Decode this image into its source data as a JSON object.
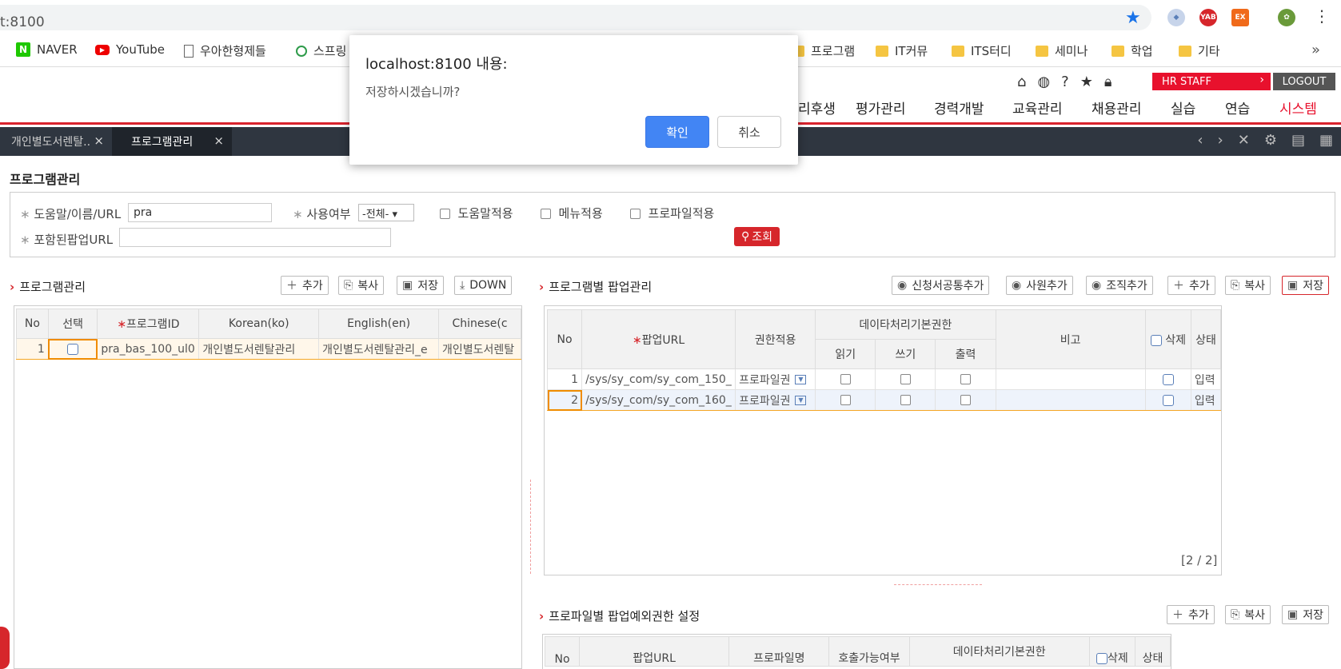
{
  "browser": {
    "address": "t:8100",
    "bookmarks": [
      {
        "label": "NAVER",
        "icon": "naver-icon"
      },
      {
        "label": "YouTube",
        "icon": "youtube-icon"
      },
      {
        "label": "우아한형제들",
        "icon": "page-icon"
      },
      {
        "label": "스프링",
        "icon": "spring-icon"
      },
      {
        "label": "프로그램",
        "icon": "folder-icon"
      },
      {
        "label": "IT커뮤",
        "icon": "folder-icon"
      },
      {
        "label": "ITS터디",
        "icon": "folder-icon"
      },
      {
        "label": "세미나",
        "icon": "folder-icon"
      },
      {
        "label": "학업",
        "icon": "folder-icon"
      },
      {
        "label": "기타",
        "icon": "folder-icon"
      }
    ],
    "more": "»"
  },
  "header": {
    "hr_staff": "HR STAFF",
    "logout": "LOGOUT",
    "menu": [
      "리후생",
      "평가관리",
      "경력개발",
      "교육관리",
      "채용관리",
      "실습",
      "연습",
      "시스템"
    ],
    "active_menu_color": "#e8112d"
  },
  "tabs": [
    {
      "label": "개인별도서렌탈..",
      "active": false
    },
    {
      "label": "프로그램관리",
      "active": true
    }
  ],
  "page": {
    "title": "프로그램관리",
    "search": {
      "help_label": "도움말/이름/URL",
      "help_value": "pra",
      "use_label": "사용여부",
      "use_value": "-전체-",
      "chk_help": "도움말적용",
      "chk_menu": "메뉴적용",
      "chk_profile": "프로파일적용",
      "popup_url_label": "포함된팝업URL",
      "popup_url_value": "",
      "search_btn": "조회"
    }
  },
  "left": {
    "title": "프로그램관리",
    "buttons": {
      "add": "추가",
      "copy": "복사",
      "save": "저장",
      "down": "DOWN"
    },
    "columns": [
      "No",
      "선택",
      "프로그램ID",
      "Korean(ko)",
      "English(en)",
      "Chinese(c"
    ],
    "rows": [
      {
        "no": "1",
        "id": "pra_bas_100_ul0",
        "ko": "개인별도서렌탈관리",
        "en": "개인별도서렌탈관리_e",
        "zh": "개인별도서렌탈"
      }
    ]
  },
  "right": {
    "title": "프로그램별 팝업관리",
    "buttons": {
      "app_common": "신청서공통추가",
      "emp": "사원추가",
      "org": "조직추가",
      "add": "추가",
      "copy": "복사",
      "save": "저장"
    },
    "columns": {
      "no": "No",
      "url": "팝업URL",
      "auth": "권한적용",
      "data_group": "데이타처리기본권한",
      "read": "읽기",
      "write": "쓰기",
      "print": "출력",
      "note": "비고",
      "delete": "삭제",
      "status": "상태"
    },
    "rows": [
      {
        "no": "1",
        "url": "/sys/sy_com/sy_com_150_",
        "auth": "프로파일권",
        "status": "입력"
      },
      {
        "no": "2",
        "url": "/sys/sy_com/sy_com_160_",
        "auth": "프로파일권",
        "status": "입력"
      }
    ],
    "pager": "[2 / 2]"
  },
  "bottom": {
    "title": "프로파일별 팝업예외권한 설정",
    "buttons": {
      "add": "추가",
      "copy": "복사",
      "save": "저장"
    },
    "columns": {
      "no": "No",
      "url": "팝업URL",
      "profile": "프로파일명",
      "output": "호출가능여부",
      "data_group": "데이타처리기본권한",
      "delete": "삭제",
      "status": "상태"
    }
  },
  "dialog": {
    "title": "localhost:8100 내용:",
    "message": "저장하시겠습니까?",
    "ok": "확인",
    "cancel": "취소"
  }
}
